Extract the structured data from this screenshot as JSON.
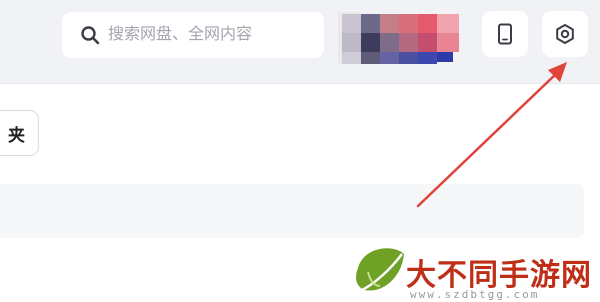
{
  "header": {
    "search": {
      "placeholder": "搜索网盘、全网内容",
      "value": "",
      "icon": "search-icon"
    },
    "buttons": [
      {
        "name": "device",
        "icon": "phone-icon"
      },
      {
        "name": "settings",
        "icon": "gear-icon"
      }
    ]
  },
  "main": {
    "folder_chip_label": "夹"
  },
  "annotation": {
    "arrow_color": "#e0433a"
  },
  "watermark": {
    "logo": "大不同手游网",
    "url": "www.szdbtgg.com",
    "accent_color": "#bf2e16",
    "icon": "leaf-logo-icon"
  },
  "colors": {
    "header_bg": "#f1f2f5",
    "accent": "#e0433a"
  }
}
